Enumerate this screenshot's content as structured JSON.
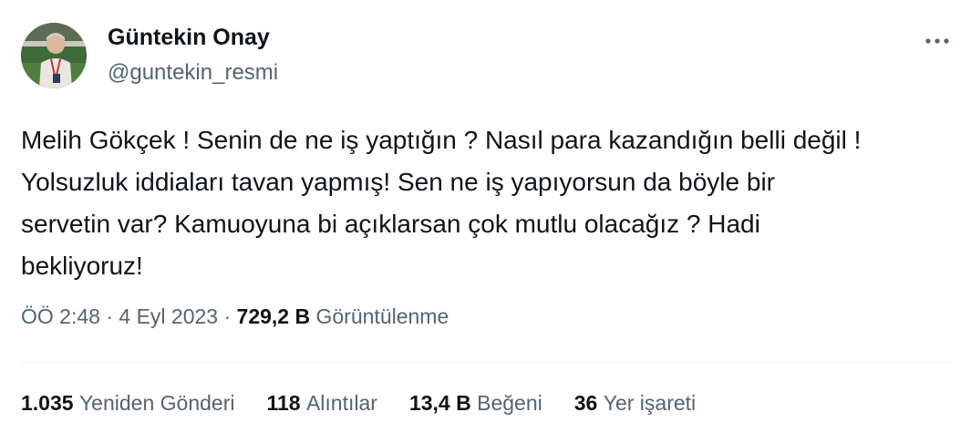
{
  "author": {
    "name": "Güntekin Onay",
    "handle": "@guntekin_resmi"
  },
  "tweet": {
    "text": "Melih Gökçek ! Senin de ne iş yaptığın ? Nasıl para kazandığın belli değil !\nYolsuzluk iddiaları tavan yapmış! Sen ne iş yapıyorsun da böyle bir\nservetin var? Kamuoyuna bi açıklarsan çok mutlu olacağız ? Hadi\nbekliyoruz!"
  },
  "meta": {
    "time": "ÖÖ 2:48",
    "separator": " · ",
    "date": "4 Eyl 2023",
    "views_count": "729,2 B",
    "views_label": "Görüntülenme"
  },
  "stats": {
    "retweets": {
      "count": "1.035",
      "label": "Yeniden Gönderi"
    },
    "quotes": {
      "count": "118",
      "label": "Alıntılar"
    },
    "likes": {
      "count": "13,4 B",
      "label": "Beğeni"
    },
    "bookmarks": {
      "count": "36",
      "label": "Yer işareti"
    }
  },
  "icons": {
    "more": "more-horizontal-icon",
    "avatar": "avatar"
  },
  "colors": {
    "text": "#0f1419",
    "secondary": "#536471",
    "divider": "#eff3f4",
    "background": "#ffffff"
  }
}
